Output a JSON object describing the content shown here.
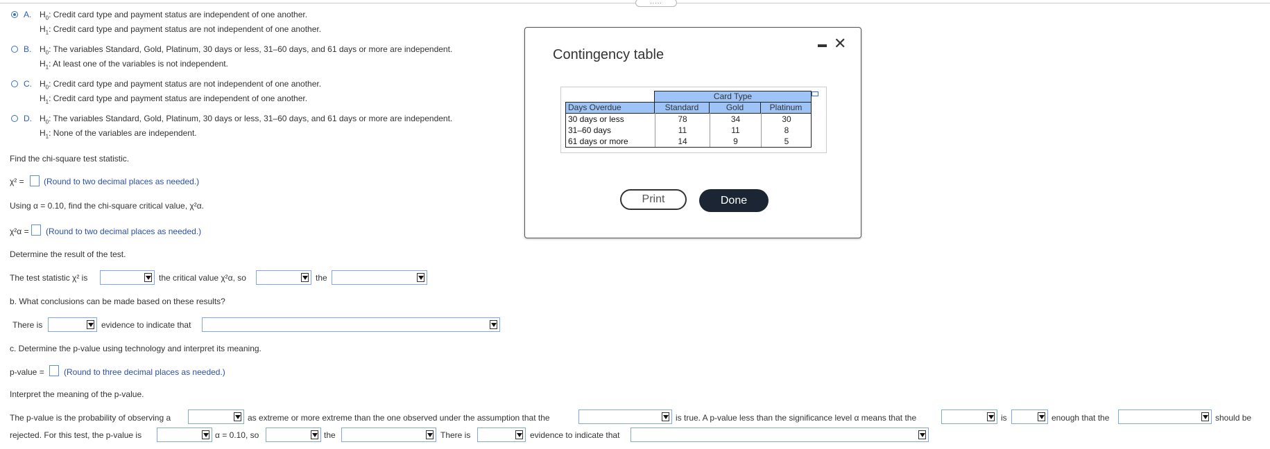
{
  "options": [
    {
      "letter": "A.",
      "h0": "Credit card type and payment status are independent of one another.",
      "h1": "Credit card type and payment status are not independent of one another.",
      "selected": true
    },
    {
      "letter": "B.",
      "h0": "The variables Standard, Gold, Platinum, 30 days or less, 31–60 days, and 61 days  or more are independent.",
      "h1": "At least one of the variables is not independent.",
      "selected": false
    },
    {
      "letter": "C.",
      "h0": "Credit card type and payment status are not independent of one another.",
      "h1": "Credit card type and payment status are independent of one another.",
      "selected": false
    },
    {
      "letter": "D.",
      "h0": "The variables Standard, Gold, Platinum, 30 days or less, 31–60 days, and 61 days  or more are independent.",
      "h1": "None of the variables are independent.",
      "selected": false
    }
  ],
  "hyp": {
    "h0_prefix": "H",
    "h0_sub": "0",
    "h1_prefix": "H",
    "h1_sub": "1",
    "colon": ":"
  },
  "q_chi_stat": "Find the chi-square test statistic.",
  "chi_stat_lhs": "χ² =",
  "round2": "(Round to two decimal places as needed.)",
  "q_crit": "Using α = 0.10, find the chi-square critical value, χ²α.",
  "crit_lhs": "χ²α =",
  "q_result": "Determine the result of the test.",
  "result_line": {
    "p1": "The test statistic χ² is",
    "p2": "the critical value χ²α, so",
    "p3": "the"
  },
  "part_b": "b. What conclusions can be made based on these results?",
  "b_line": {
    "p1": "There is",
    "p2": "evidence to indicate that"
  },
  "part_c": "c. Determine the p-value using technology and interpret its meaning.",
  "pvalue_lhs": "p-value =",
  "round3": "(Round to three decimal places as needed.)",
  "interpret": "Interpret the meaning of the p-value.",
  "interp_line1": {
    "p1": "The p-value is the probability of observing a",
    "p2": "as extreme or more extreme than the one observed under the assumption that the",
    "p3": "is true. A p-value less than the significance level α means that the",
    "p4": "is",
    "p5": "enough that the",
    "p6": "should be"
  },
  "interp_line2": {
    "p1": "rejected. For this test, the p-value is",
    "p2": "α = 0.10, so",
    "p3": "the",
    "p4": "There is",
    "p5": "evidence to indicate that"
  },
  "modal": {
    "title": "Contingency table",
    "card_type": "Card Type",
    "days_overdue": "Days Overdue",
    "columns": [
      "Standard",
      "Gold",
      "Platinum"
    ],
    "rows": [
      {
        "label": "30 days or less",
        "values": [
          "78",
          "34",
          "30"
        ]
      },
      {
        "label": "31–60 days",
        "values": [
          "11",
          "11",
          "8"
        ]
      },
      {
        "label": "61 days or more",
        "values": [
          "14",
          "9",
          "5"
        ]
      }
    ],
    "print": "Print",
    "done": "Done",
    "close": "✕"
  },
  "drag_handle": "....."
}
